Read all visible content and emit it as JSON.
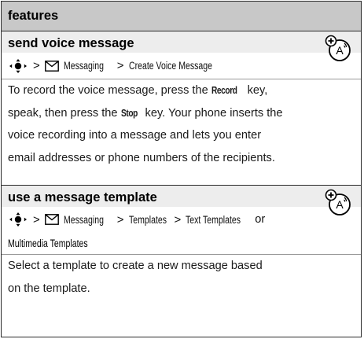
{
  "header": {
    "title": "features"
  },
  "sections": [
    {
      "title": "send voice message",
      "path": {
        "sep": ">",
        "menu": "Messaging",
        "item": "Create Voice Message"
      },
      "lines": [
        {
          "pre": "To record the voice message, press the ",
          "key": "Record",
          "post": " key,"
        },
        {
          "pre": "speak, then press the ",
          "key": "Stop",
          "post": " key. Your phone inserts the"
        },
        {
          "pre": "voice recording into a message and lets you enter",
          "key": "",
          "post": ""
        },
        {
          "pre": "email addresses or phone numbers of the recipients.",
          "key": "",
          "post": ""
        }
      ]
    },
    {
      "title": "use a message template",
      "path": {
        "sep": ">",
        "menu": "Messaging",
        "sep2": ">",
        "item": "Templates",
        "sep3": ">",
        "item2": "Text Templates",
        "or": "or",
        "cont": "Multimedia Templates"
      },
      "lines": [
        {
          "text": "Select a template to create a new message based"
        },
        {
          "text": "on the template."
        }
      ]
    }
  ]
}
